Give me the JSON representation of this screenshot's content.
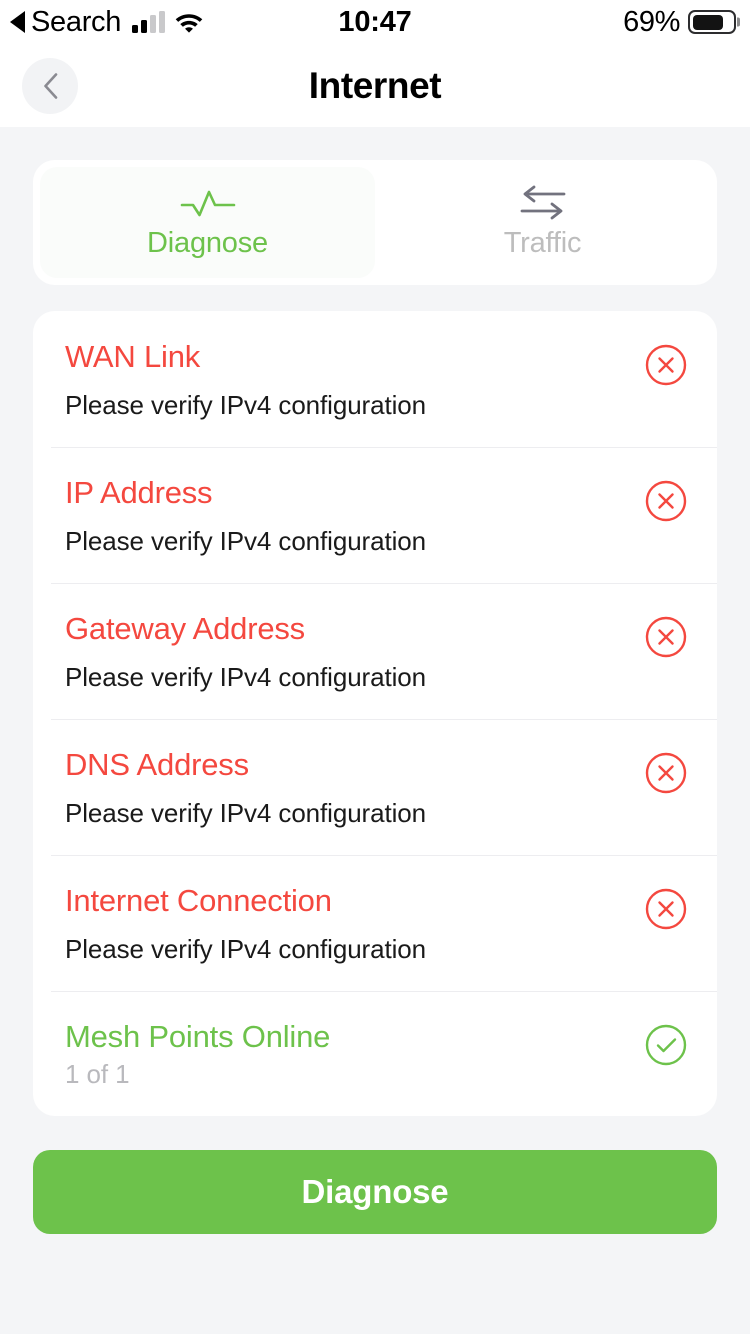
{
  "status_bar": {
    "back_label": "Search",
    "back_icon": "triangle-left-icon",
    "signal_icon": "cellular-signal-icon",
    "signal_bars_filled": 2,
    "signal_bars_total": 4,
    "wifi_icon": "wifi-icon",
    "time": "10:47",
    "battery_percent_label": "69%",
    "battery_level": 69,
    "battery_icon": "battery-icon"
  },
  "nav": {
    "back_icon": "chevron-left-icon",
    "title": "Internet"
  },
  "tabs": [
    {
      "label": "Diagnose",
      "icon": "pulse-icon",
      "active": true
    },
    {
      "label": "Traffic",
      "icon": "exchange-arrows-icon",
      "active": false
    }
  ],
  "diagnostics": [
    {
      "title": "WAN Link",
      "subtitle": "Please verify IPv4 configuration",
      "status": "error",
      "icon": "error-circle-x-icon"
    },
    {
      "title": "IP Address",
      "subtitle": "Please verify IPv4 configuration",
      "status": "error",
      "icon": "error-circle-x-icon"
    },
    {
      "title": "Gateway Address",
      "subtitle": "Please verify IPv4 configuration",
      "status": "error",
      "icon": "error-circle-x-icon"
    },
    {
      "title": "DNS Address",
      "subtitle": "Please verify IPv4 configuration",
      "status": "error",
      "icon": "error-circle-x-icon"
    },
    {
      "title": "Internet Connection",
      "subtitle": "Please verify IPv4 configuration",
      "status": "error",
      "icon": "error-circle-x-icon"
    },
    {
      "title": "Mesh Points Online",
      "subtitle": "1 of 1",
      "status": "ok",
      "icon": "success-circle-check-icon"
    }
  ],
  "action_button": {
    "label": "Diagnose"
  },
  "colors": {
    "accent_green": "#6dc24b",
    "error_red": "#f4483f",
    "page_background": "#f4f5f7",
    "card_background": "#ffffff",
    "muted_gray": "#bdbdbd"
  }
}
